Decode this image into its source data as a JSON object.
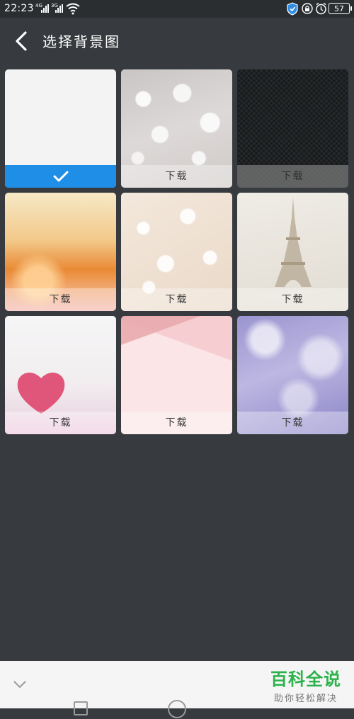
{
  "status": {
    "time": "22:23",
    "sim1": "4G",
    "sim2": "3G",
    "battery": "57"
  },
  "header": {
    "title": "选择背景图"
  },
  "tiles": [
    {
      "id": "plain-white",
      "state": "selected"
    },
    {
      "id": "silver-bokeh",
      "label": "下载"
    },
    {
      "id": "dark-carbon",
      "label": "下载"
    },
    {
      "id": "golden-sparkle",
      "label": "下载"
    },
    {
      "id": "cream-flowers",
      "label": "下载"
    },
    {
      "id": "eiffel-tower",
      "label": "下载"
    },
    {
      "id": "pink-heart",
      "label": "下载"
    },
    {
      "id": "pink-paper",
      "label": "下载"
    },
    {
      "id": "purple-raindrops",
      "label": "下载"
    }
  ],
  "colors": {
    "background": "#373a3e",
    "selected": "#1f8ee6",
    "watermark_green": "#2bb24a"
  },
  "watermark": {
    "title": "百科全说",
    "subtitle": "助你轻松解决"
  },
  "icons": [
    "back-arrow-icon",
    "checkmark-icon",
    "wifi-icon",
    "shield-icon",
    "lock-icon",
    "alarm-icon",
    "battery-icon",
    "nav-back-icon",
    "nav-recent-icon",
    "nav-home-icon"
  ]
}
